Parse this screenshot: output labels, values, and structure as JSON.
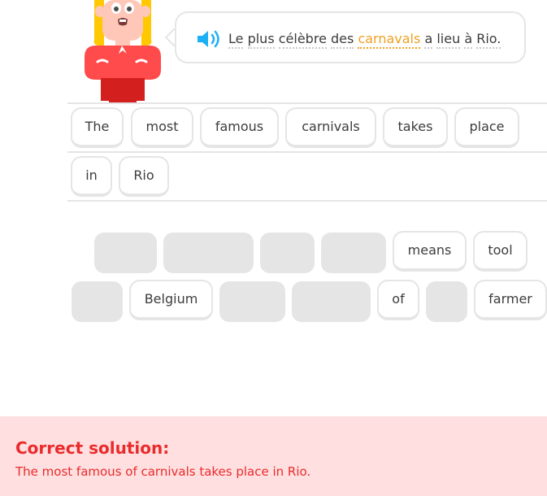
{
  "prompt": {
    "parts": [
      {
        "text": "Le"
      },
      {
        "text": "plus"
      },
      {
        "text": "célèbre"
      },
      {
        "text": "des"
      },
      {
        "text": "carnavals",
        "highlight": true
      },
      {
        "text": "a"
      },
      {
        "text": "lieu"
      },
      {
        "text": "à"
      },
      {
        "text": "Rio."
      }
    ]
  },
  "answer": {
    "words": [
      "The",
      "most",
      "famous",
      "carnivals",
      "takes",
      "place",
      "in",
      "Rio"
    ]
  },
  "word_bank": {
    "words": [
      "means",
      "tool",
      "Belgium",
      "of",
      "farmer"
    ]
  },
  "solution": {
    "title": "Correct solution:",
    "text": "The most famous of carnivals takes place in Rio."
  },
  "colors": {
    "accent": "#1cb0f6",
    "highlight": "#f0a023",
    "error": "#ea2b2b",
    "error_bg": "#ffdfe0",
    "border": "#e5e5e5"
  }
}
